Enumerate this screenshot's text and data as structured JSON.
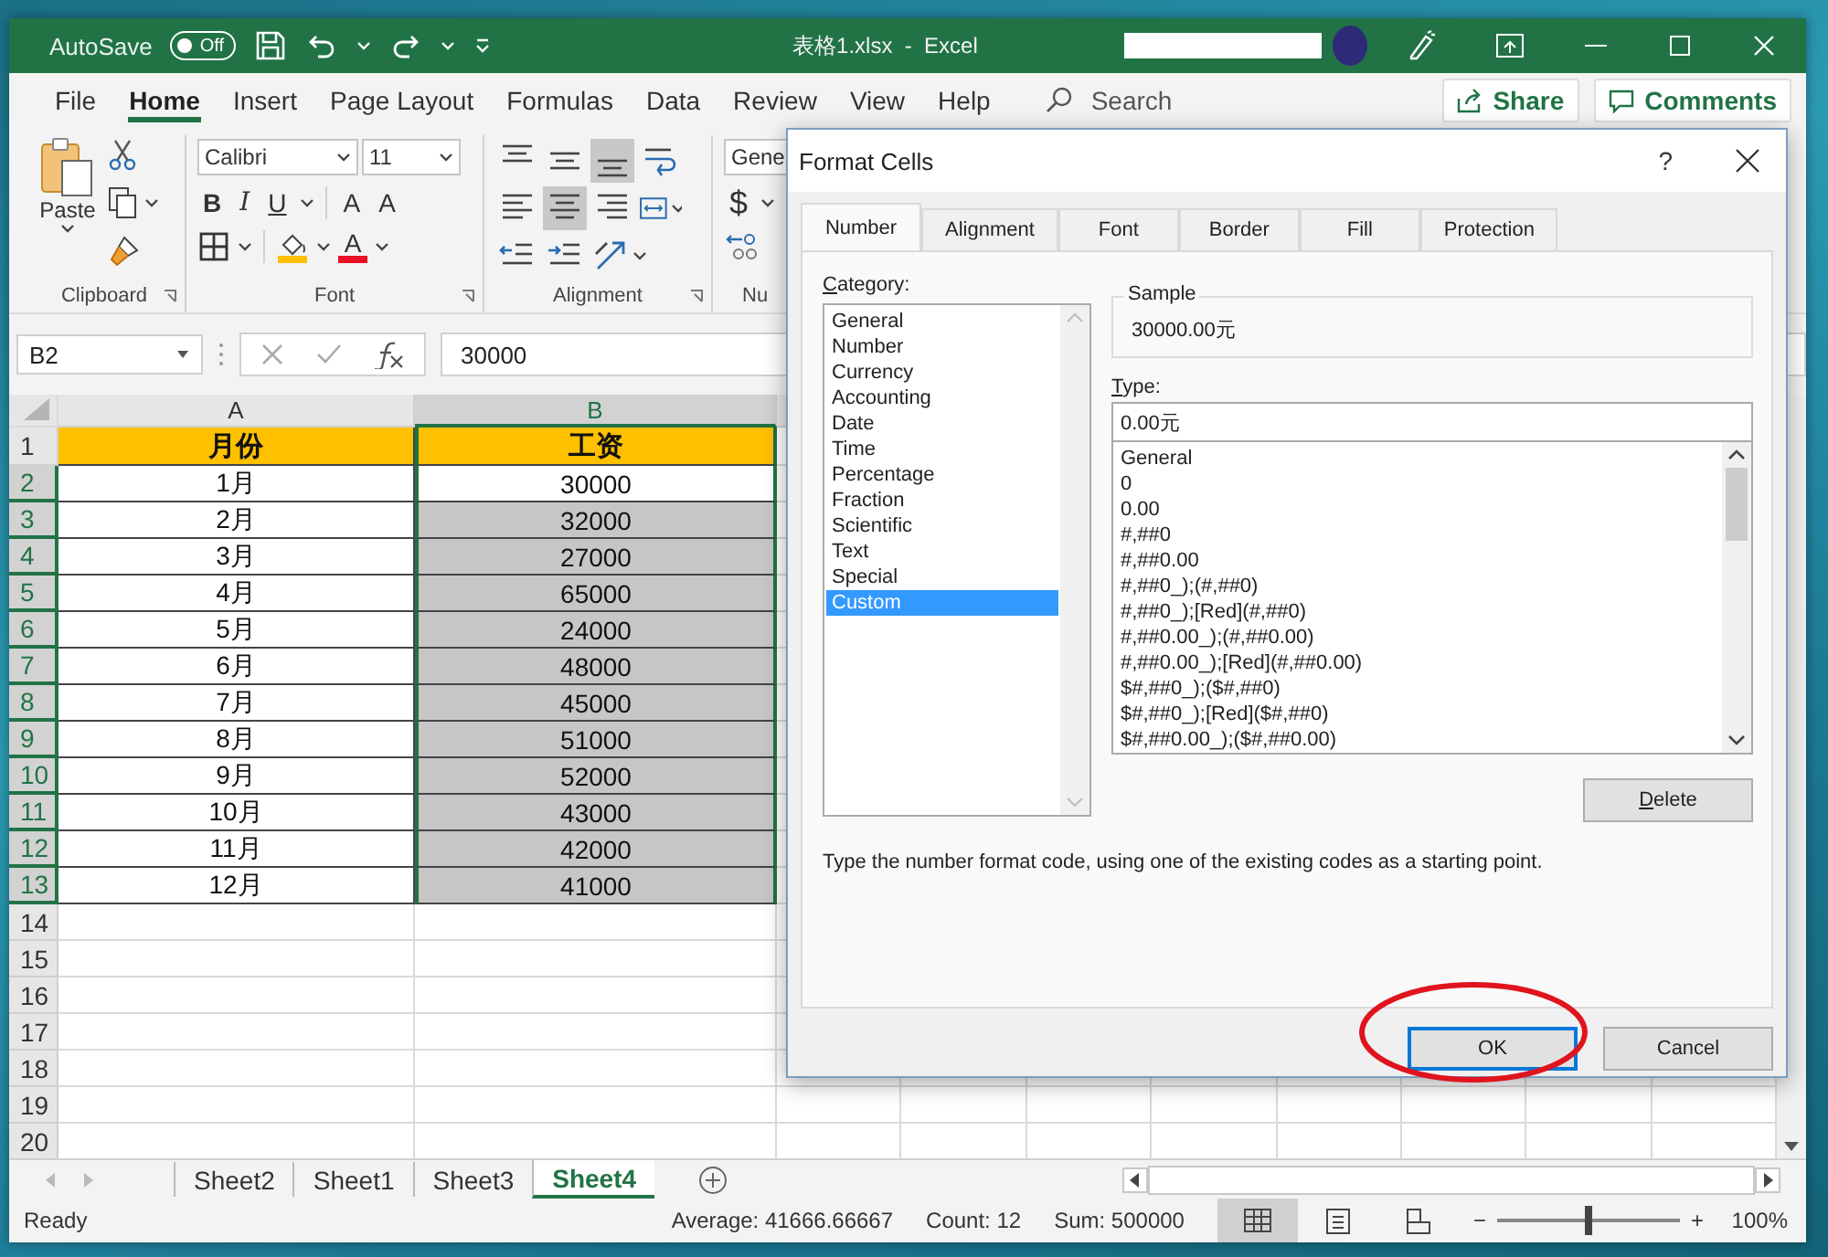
{
  "title_bar": {
    "autosave_label": "AutoSave",
    "autosave": {
      "on": false,
      "label": "Off"
    },
    "title": "表格1.xlsx  -  Excel"
  },
  "ribbon_tabs": [
    {
      "label": "File",
      "selected": false
    },
    {
      "label": "Home",
      "selected": true
    },
    {
      "label": "Insert",
      "selected": false
    },
    {
      "label": "Page Layout",
      "selected": false
    },
    {
      "label": "Formulas",
      "selected": false
    },
    {
      "label": "Data",
      "selected": false
    },
    {
      "label": "Review",
      "selected": false
    },
    {
      "label": "View",
      "selected": false
    },
    {
      "label": "Help",
      "selected": false
    }
  ],
  "search": {
    "placeholder": "Search"
  },
  "share_button": "Share",
  "comments_button": "Comments",
  "ribbon": {
    "clipboard": {
      "paste": "Paste",
      "label": "Clipboard"
    },
    "font": {
      "family": "Calibri",
      "size": "11",
      "bold": "B",
      "italic": "I",
      "underline": "U",
      "grow": "A",
      "shrink": "A",
      "font_color": "A",
      "label": "Font"
    },
    "alignment": {
      "label": "Alignment",
      "buttons": [
        {
          "kind": "align-top",
          "selected": false
        },
        {
          "kind": "align-middle",
          "selected": false
        },
        {
          "kind": "align-bottom",
          "selected": true
        },
        {
          "kind": "wrap",
          "selected": false
        },
        {
          "kind": "align-left",
          "selected": false
        },
        {
          "kind": "align-center",
          "selected": true
        },
        {
          "kind": "align-right",
          "selected": false
        },
        {
          "kind": "merge",
          "selected": false
        },
        {
          "kind": "indent-decrease",
          "selected": false
        },
        {
          "kind": "indent-increase",
          "selected": false
        },
        {
          "kind": "orientation",
          "selected": false
        }
      ]
    },
    "number": {
      "format": "Gene",
      "currency": "$",
      "label": "Nu"
    }
  },
  "formula_bar": {
    "name_box": "B2",
    "value": "30000"
  },
  "sheet": {
    "columns": [
      {
        "label": "A",
        "selected": false
      },
      {
        "label": "B",
        "selected": true
      }
    ],
    "header_row": {
      "row": "1",
      "cells": [
        "月份",
        "工资"
      ]
    },
    "rows": [
      {
        "row": "2",
        "month": "1月",
        "salary": "30000",
        "selected": true,
        "active": true
      },
      {
        "row": "3",
        "month": "2月",
        "salary": "32000",
        "selected": true,
        "active": false
      },
      {
        "row": "4",
        "month": "3月",
        "salary": "27000",
        "selected": true,
        "active": false
      },
      {
        "row": "5",
        "month": "4月",
        "salary": "65000",
        "selected": true,
        "active": false
      },
      {
        "row": "6",
        "month": "5月",
        "salary": "24000",
        "selected": true,
        "active": false
      },
      {
        "row": "7",
        "month": "6月",
        "salary": "48000",
        "selected": true,
        "active": false
      },
      {
        "row": "8",
        "month": "7月",
        "salary": "45000",
        "selected": true,
        "active": false
      },
      {
        "row": "9",
        "month": "8月",
        "salary": "51000",
        "selected": true,
        "active": false
      },
      {
        "row": "10",
        "month": "9月",
        "salary": "52000",
        "selected": true,
        "active": false
      },
      {
        "row": "11",
        "month": "10月",
        "salary": "43000",
        "selected": true,
        "active": false
      },
      {
        "row": "12",
        "month": "11月",
        "salary": "42000",
        "selected": true,
        "active": false
      },
      {
        "row": "13",
        "month": "12月",
        "salary": "41000",
        "selected": true,
        "active": false
      }
    ],
    "empty_rows": [
      "14",
      "15",
      "16",
      "17",
      "18",
      "19",
      "20"
    ]
  },
  "dialog": {
    "title": "Format Cells",
    "help": "?",
    "tabs": [
      {
        "label": "Number",
        "selected": true
      },
      {
        "label": "Alignment",
        "selected": false
      },
      {
        "label": "Font",
        "selected": false
      },
      {
        "label": "Border",
        "selected": false
      },
      {
        "label": "Fill",
        "selected": false
      },
      {
        "label": "Protection",
        "selected": false
      }
    ],
    "category_label": "Category:",
    "categories": [
      {
        "label": "General",
        "selected": false
      },
      {
        "label": "Number",
        "selected": false
      },
      {
        "label": "Currency",
        "selected": false
      },
      {
        "label": "Accounting",
        "selected": false
      },
      {
        "label": "Date",
        "selected": false
      },
      {
        "label": "Time",
        "selected": false
      },
      {
        "label": "Percentage",
        "selected": false
      },
      {
        "label": "Fraction",
        "selected": false
      },
      {
        "label": "Scientific",
        "selected": false
      },
      {
        "label": "Text",
        "selected": false
      },
      {
        "label": "Special",
        "selected": false
      },
      {
        "label": "Custom",
        "selected": true
      }
    ],
    "sample_label": "Sample",
    "sample_value": "30000.00元",
    "type_label": "Type:",
    "type_value": "0.00元",
    "formats": [
      "General",
      "0",
      "0.00",
      "#,##0",
      "#,##0.00",
      "#,##0_);(#,##0)",
      "#,##0_);[Red](#,##0)",
      "#,##0.00_);(#,##0.00)",
      "#,##0.00_);[Red](#,##0.00)",
      "$#,##0_);($#,##0)",
      "$#,##0_);[Red]($#,##0)",
      "$#,##0.00_);($#,##0.00)"
    ],
    "delete_button": "Delete",
    "description": "Type the number format code, using one of the existing codes as a starting point.",
    "ok_button": "OK",
    "cancel_button": "Cancel"
  },
  "sheet_tabs": [
    {
      "label": "Sheet2",
      "selected": false
    },
    {
      "label": "Sheet1",
      "selected": false
    },
    {
      "label": "Sheet3",
      "selected": false
    },
    {
      "label": "Sheet4",
      "selected": true
    }
  ],
  "status_bar": {
    "ready": "Ready",
    "average": "Average: 41666.66667",
    "count": "Count: 12",
    "sum": "Sum: 500000",
    "views": [
      {
        "kind": "normal",
        "selected": true
      },
      {
        "kind": "page-layout",
        "selected": false
      },
      {
        "kind": "page-break",
        "selected": false
      }
    ],
    "zoom": {
      "minus": "−",
      "plus": "+",
      "level": 0.5,
      "reading": "100%"
    }
  }
}
